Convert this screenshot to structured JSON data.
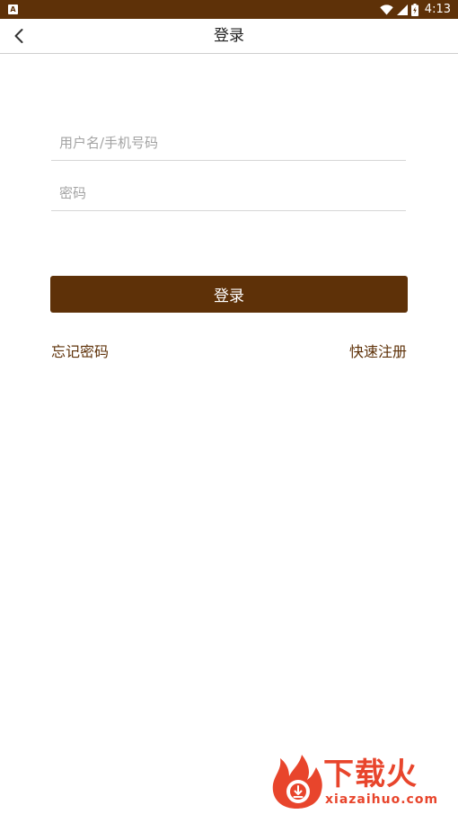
{
  "status_bar": {
    "notification_icon": "a-letter-icon",
    "notification_letter": "A",
    "icons": [
      "wifi-icon",
      "signal-icon",
      "battery-icon"
    ],
    "time": "4:13"
  },
  "app_bar": {
    "back_icon": "chevron-left-icon",
    "title": "登录"
  },
  "form": {
    "username": {
      "value": "",
      "placeholder": "用户名/手机号码"
    },
    "password": {
      "value": "",
      "placeholder": "密码"
    },
    "login_label": "登录",
    "forgot_label": "忘记密码",
    "register_label": "快速注册"
  },
  "watermark": {
    "brand": "下载火",
    "domain": "xiazaihuo.com"
  },
  "colors": {
    "primary": "#5e3108",
    "watermark": "#e8452c",
    "divider": "#d6d6d6",
    "placeholder": "#a3a3a3"
  }
}
